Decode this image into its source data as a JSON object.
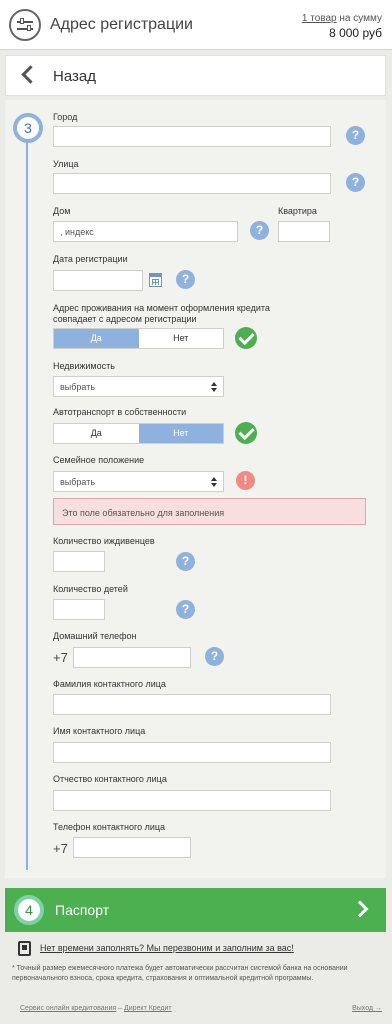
{
  "header": {
    "title": "Адрес регистрации",
    "cart_link": "1 товар",
    "cart_text": " на сумму",
    "cart_sum": "8 000 руб"
  },
  "back": {
    "label": "Назад"
  },
  "step": {
    "current": "3",
    "next": "4",
    "next_label": "Паспорт"
  },
  "form": {
    "city": {
      "label": "Город",
      "value": ""
    },
    "street": {
      "label": "Улица",
      "value": ""
    },
    "house": {
      "label": "Дом",
      "placeholder": ", индекс"
    },
    "flat": {
      "label": "Квартира",
      "value": ""
    },
    "reg_date": {
      "label": "Дата регистрации",
      "value": ""
    },
    "same_address": {
      "label_line1": "Адрес проживания на момент оформления кредита",
      "label_line2": "совпадает с адресом регистрации",
      "yes": "Да",
      "no": "Нет",
      "selected": "Да"
    },
    "property": {
      "label": "Недвижимость",
      "value": "выбрать"
    },
    "car": {
      "label": "Автотранспорт в собственности",
      "yes": "Да",
      "no": "Нет",
      "selected": "Нет"
    },
    "marital": {
      "label": "Семейное положение",
      "value": "выбрать",
      "error": "Это поле обязательно для заполнения"
    },
    "dependents": {
      "label": "Количество иждивенцев",
      "value": ""
    },
    "children": {
      "label": "Количество детей",
      "value": ""
    },
    "home_phone": {
      "label": "Домашний телефон",
      "prefix": "+7"
    },
    "contact_last": {
      "label": "Фамилия контактного лица"
    },
    "contact_first": {
      "label": "Имя контактного лица"
    },
    "contact_middle": {
      "label": "Отчество контактного лица"
    },
    "contact_phone": {
      "label": "Телефон контактного лица",
      "prefix": "+7"
    }
  },
  "help_glyph": "?",
  "warn_glyph": "!",
  "footer": {
    "callback": "Нет времени заполнять? Мы перезвоним и заполним за вас!",
    "note": "* Точный размер ежемесячного платежа будет автоматически рассчитан системой банка на основании первоначального взноса, срока кредита, страхования и оптимальной кредитной программы.",
    "service_link": "Сервис онлайн кредитования",
    "service_sep": " – ",
    "service_brand": "Директ Кредит",
    "logout": "Выход →"
  },
  "colors": {
    "accent": "#8fb1dd",
    "success": "#4caf50",
    "error_bg": "#f8dede"
  },
  "icons": [
    "settings-sliders-icon",
    "chevron-left-icon",
    "help-icon",
    "calendar-icon",
    "check-icon",
    "warning-icon",
    "chevron-right-icon",
    "phone-icon"
  ]
}
